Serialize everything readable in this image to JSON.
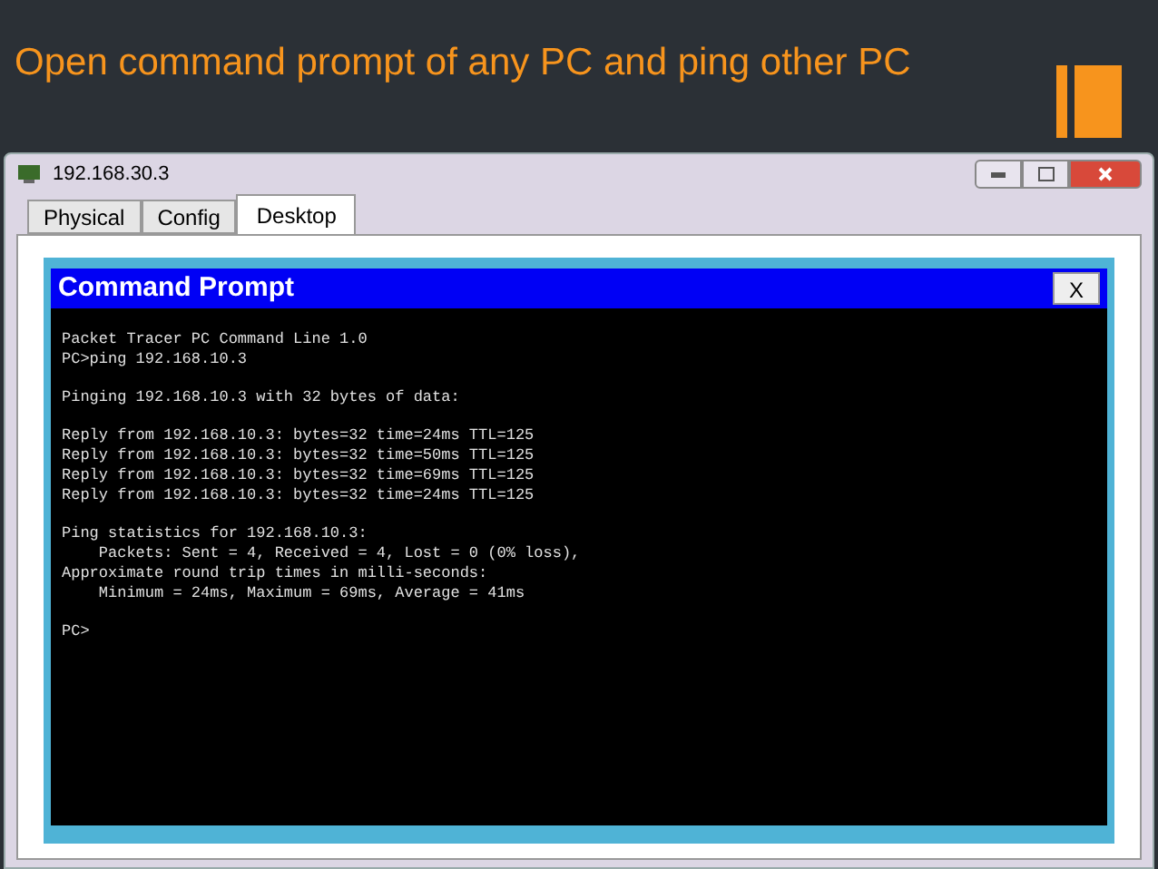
{
  "slide": {
    "title": "Open command prompt of any PC and ping other PC"
  },
  "window": {
    "title": "192.168.30.3"
  },
  "tabs": [
    {
      "label": "Physical",
      "selected": false
    },
    {
      "label": "Config",
      "selected": false
    },
    {
      "label": "Desktop",
      "selected": true
    }
  ],
  "command_prompt": {
    "title": "Command Prompt",
    "close": "X",
    "paragraphs": [
      [
        "Packet Tracer PC Command Line 1.0",
        "PC>ping 192.168.10.3"
      ],
      [
        "Pinging 192.168.10.3 with 32 bytes of data:"
      ],
      [
        "Reply from 192.168.10.3: bytes=32 time=24ms TTL=125",
        "Reply from 192.168.10.3: bytes=32 time=50ms TTL=125",
        "Reply from 192.168.10.3: bytes=32 time=69ms TTL=125",
        "Reply from 192.168.10.3: bytes=32 time=24ms TTL=125"
      ],
      [
        "Ping statistics for 192.168.10.3:",
        "    Packets: Sent = 4, Received = 4, Lost = 0 (0% loss),",
        "Approximate round trip times in milli-seconds:",
        "    Minimum = 24ms, Maximum = 69ms, Average = 41ms"
      ],
      [
        "PC>"
      ]
    ]
  }
}
